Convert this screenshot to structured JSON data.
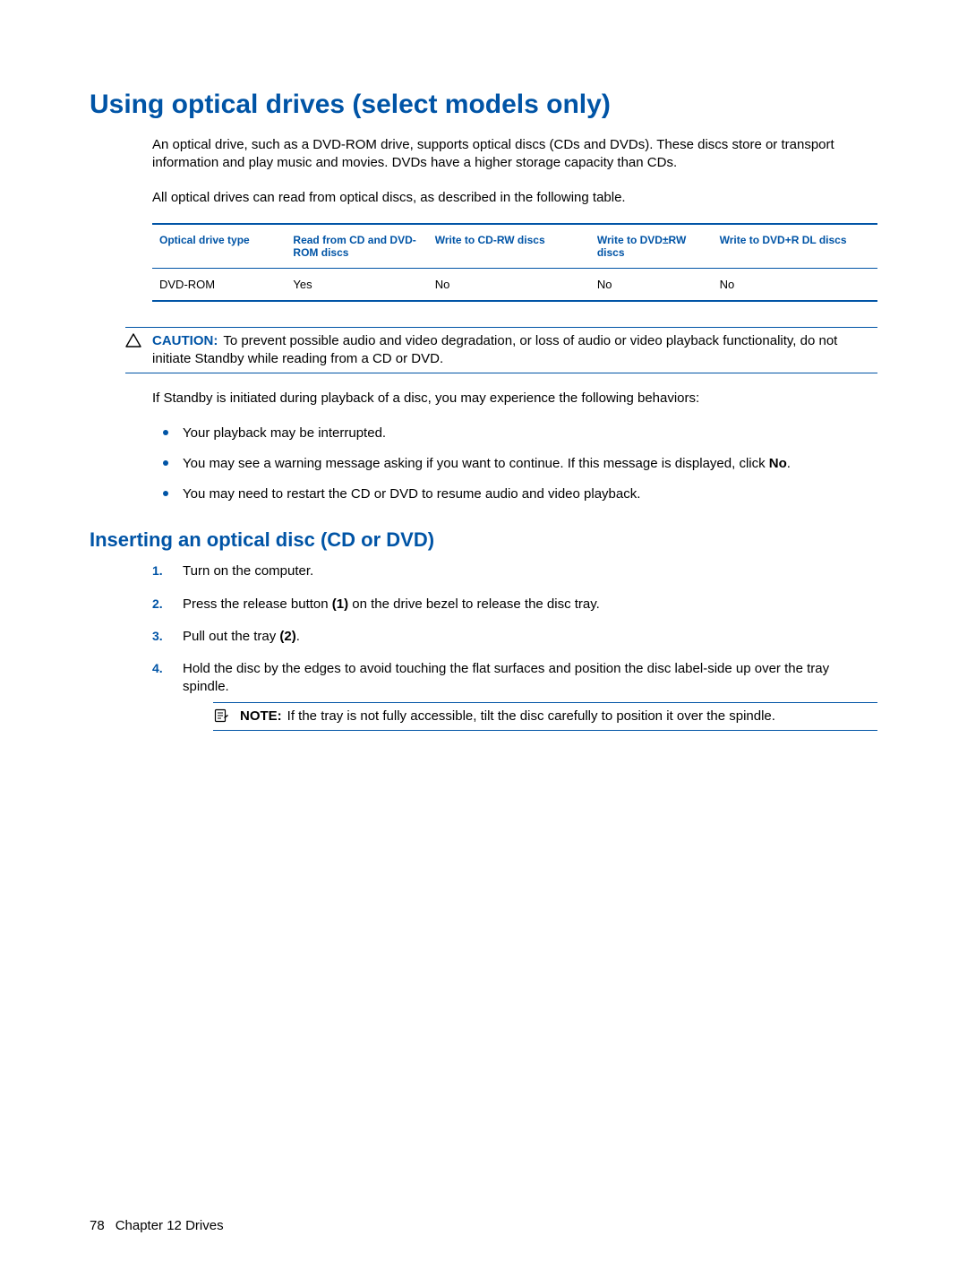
{
  "h1": "Using optical drives (select models only)",
  "intro1": "An optical drive, such as a DVD-ROM drive, supports optical discs (CDs and DVDs). These discs store or transport information and play music and movies. DVDs have a higher storage capacity than CDs.",
  "intro2": "All optical drives can read from optical discs, as described in the following table.",
  "table": {
    "headers": {
      "c1": "Optical drive type",
      "c2": "Read from CD and DVD-ROM discs",
      "c3": "Write to CD-RW discs",
      "c4": "Write to DVD±RW discs",
      "c5": "Write to DVD+R DL discs"
    },
    "row": {
      "c1": "DVD-ROM",
      "c2": "Yes",
      "c3": "No",
      "c4": "No",
      "c5": "No"
    }
  },
  "caution": {
    "label": "CAUTION:",
    "text": "To prevent possible audio and video degradation, or loss of audio or video playback functionality, do not initiate Standby while reading from a CD or DVD."
  },
  "standbyIntro": "If Standby is initiated during playback of a disc, you may experience the following behaviors:",
  "bullets": {
    "b1": "Your playback may be interrupted.",
    "b2a": "You may see a warning message asking if you want to continue. If this message is displayed, click ",
    "b2b": "No",
    "b2c": ".",
    "b3": "You may need to restart the CD or DVD to resume audio and video playback."
  },
  "h2": "Inserting an optical disc CD or DVD)",
  "h2_real": "Inserting an optical disc (CD or DVD)",
  "steps": {
    "s1": "Turn on the computer.",
    "s2a": "Press the release button ",
    "s2b": "(1)",
    "s2c": " on the drive bezel to release the disc tray.",
    "s3a": "Pull out the tray ",
    "s3b": "(2)",
    "s3c": ".",
    "s4": "Hold the disc by the edges to avoid touching the flat surfaces and position the disc label-side up over the tray spindle.",
    "noteLabel": "NOTE:",
    "noteText": "If the tray is not fully accessible, tilt the disc carefully to position it over the spindle."
  },
  "footer": {
    "pageNum": "78",
    "chapter": "Chapter 12   Drives"
  }
}
